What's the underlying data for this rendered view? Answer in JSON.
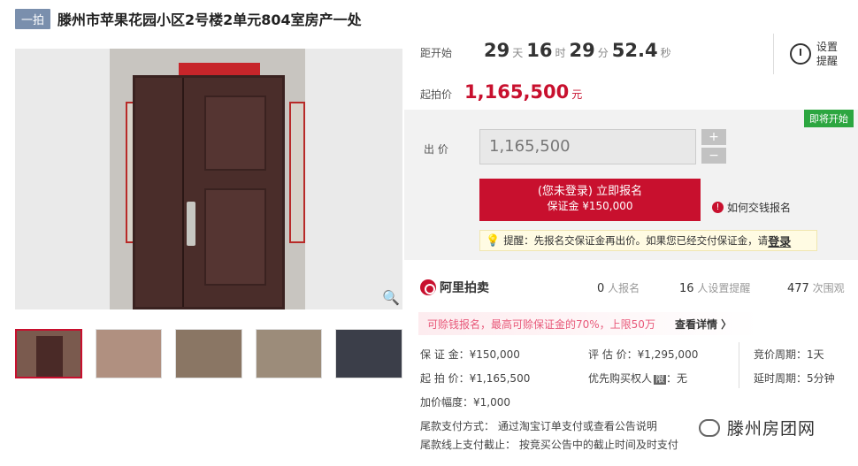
{
  "header": {
    "tag": "一拍",
    "title": "滕州市苹果花园小区2号楼2单元804室房产一处"
  },
  "countdown": {
    "label": "距开始",
    "days": "29",
    "days_unit": "天",
    "hours": "16",
    "hours_unit": "时",
    "minutes": "29",
    "minutes_unit": "分",
    "seconds": "52.4",
    "seconds_unit": "秒"
  },
  "remind": {
    "line1": "设置",
    "line2": "提醒"
  },
  "start_price": {
    "label": "起拍价",
    "value": "1,165,500",
    "unit": "元"
  },
  "bid": {
    "status": "即将开始",
    "label": "出 价",
    "value": "1,165,500",
    "plus": "+",
    "minus": "−",
    "signup_line1": "(您未登录) 立即报名",
    "signup_line2": "保证金 ¥150,000",
    "how_icon": "!",
    "how_text": "如何交钱报名",
    "tip_text": "提醒：先报名交保证金再出价。如果您已经交付保证金，请",
    "tip_login": "登录"
  },
  "brand": {
    "logo": "阿里拍卖"
  },
  "stats": {
    "signup_count": "0",
    "signup_label": "人报名",
    "remind_count": "16",
    "remind_label": "人设置提醒",
    "view_count": "477",
    "view_label": "次围观"
  },
  "promo": {
    "text": "可赊钱报名，最高可赊保证金的70%，上限50万",
    "detail": "查看详情 〉"
  },
  "details": {
    "deposit": "保 证 金：¥150,000",
    "start": "起 拍 价：¥1,165,500",
    "increment": "加价幅度：¥1,000",
    "appraise": "评 估 价：¥1,295,000",
    "priority": "优先购买权人",
    "priority_badge": "限",
    "priority_value": "：无",
    "cycle": "竞价周期：1天",
    "extend": "延时周期：5分钟",
    "pay_method": "尾款支付方式：  通过淘宝订单支付或查看公告说明",
    "pay_deadline": "尾款线上支付截止：  按竞买公告中的截止时间及时支付"
  },
  "watermark": {
    "text": "滕州房团网"
  },
  "icons": {
    "zoom": "zoom-icon",
    "clock": "alarm-clock-icon",
    "bulb": "lightbulb-icon"
  }
}
